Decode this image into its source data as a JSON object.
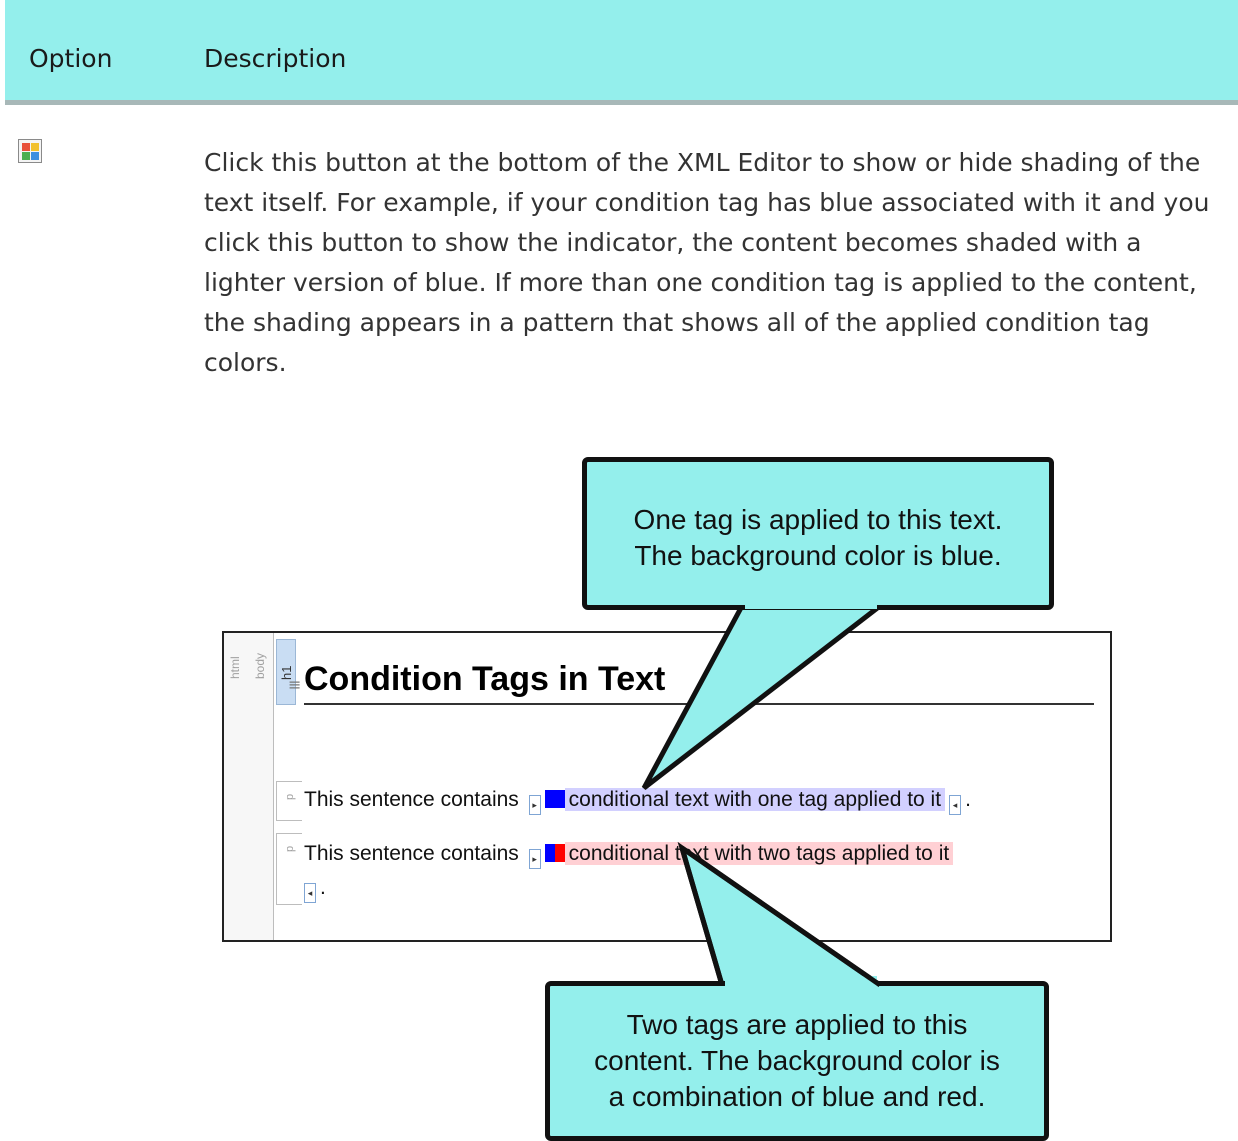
{
  "table": {
    "headers": {
      "option": "Option",
      "description": "Description"
    },
    "row": {
      "icon": "condition-tag-shading-icon",
      "description": "Click this button at the bottom of the XML Editor to show or hide shading of the text itself. For example, if your condition tag has blue associated with it and you click this button to show the indicator, the content becomes shaded with a lighter version of blue. If more than one condition tag is applied to the content, the shading appears in a pattern that shows all of the applied condition tag colors."
    }
  },
  "figure": {
    "structure_bars": {
      "html": "html",
      "body": "body",
      "h1": "h1",
      "p": "p"
    },
    "heading": "Condition Tags in Text",
    "line1": {
      "prefix": "This sentence contains",
      "conditional": "conditional text with one tag applied to it",
      "suffix": "."
    },
    "line2": {
      "prefix": "This sentence contains",
      "conditional": "conditional text with two tags applied to it",
      "suffix": "."
    },
    "callout_top": [
      "One tag is applied to this text.",
      "The background color is blue."
    ],
    "callout_bottom": [
      "Two tags are applied to this",
      "content. The background color is",
      "a combination of blue and red."
    ]
  },
  "colors": {
    "header_bg": "#94efec",
    "callout_bg": "#94efec",
    "tag_blue": "#0000ff",
    "tag_red": "#ff0000",
    "shade_blue": "#d2d0ff",
    "shade_red": "#ffd0d4"
  }
}
